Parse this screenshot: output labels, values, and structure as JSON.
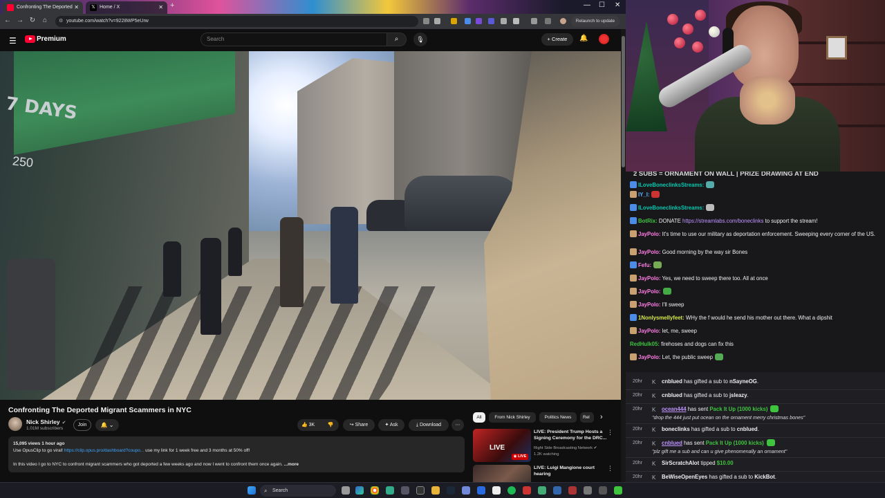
{
  "browser": {
    "tabs": [
      {
        "label": "Confronting The Deported",
        "active": true
      },
      {
        "label": "Home / X",
        "active": false
      }
    ],
    "new_tab": "+",
    "url": "youtube.com/watch?v=9228WP5eUrw",
    "relaunch_label": "Relaunch to update",
    "window_controls": {
      "minimize": "—",
      "maximize": "☐",
      "close": "✕"
    }
  },
  "youtube": {
    "brand": "Premium",
    "search_placeholder": "Search",
    "create_label": "+ Create",
    "video": {
      "overlay_days": "7 DAYS",
      "overlay_num": "250",
      "title": "Confronting The Deported Migrant Scammers in NYC",
      "channel": "Nick Shirley",
      "verified": "✔",
      "subscribers": "1.01M subscribers",
      "join_label": "Join",
      "subscribed_label": "🔔 ⌄",
      "actions": {
        "likes": "👍 3K",
        "dislike": "👎",
        "share": "↪ Share",
        "ask": "✦ Ask",
        "download": "⤓ Download",
        "more": "⋯"
      },
      "description": {
        "stats": "15,095 views  1 hour ago",
        "line1_pre": "Use OpusClip to go viral! ",
        "line1_link": "https://clip.opus.pro/dashboard?coupo...",
        "line1_post": " use my link for 1 week free and 3 months at 50% off!",
        "line2": "In this video I go to NYC to confront migrant scammers who got deported a few weeks ago and now I went to confront them once again. ",
        "more": "...more"
      }
    },
    "chips": [
      "All",
      "From Nick Shirley",
      "Politics News",
      "Rel"
    ],
    "chips_next": "›",
    "recommendations": [
      {
        "title": "LIVE: President Trump Hosts a Signing Ceremony for the DRC...",
        "channel": "Right Side Broadcasting Network ✔",
        "meta": "1.2K watching",
        "badge": "LIVE",
        "thumb_live": "LIVE"
      },
      {
        "title": "LIVE: Luigi Mangione court hearing",
        "channel": "",
        "meta": ""
      }
    ]
  },
  "stream": {
    "banner": "2 SUBS = ORNAMENT ON WALL | PRIZE DRAWING AT END",
    "messages": [
      {
        "user": "ILoveBoneclinksStreams:",
        "color": "#00c8af",
        "text": ""
      },
      {
        "user": "IY_I:",
        "color": "#5fb0ff",
        "text": ""
      },
      {
        "user": "ILoveBoneclinksStreams:",
        "color": "#00c8af",
        "text": ""
      },
      {
        "user": "BotRix:",
        "color": "#3ec43e",
        "text": " DONATE ",
        "link": "https://streamlabs.com/boneclinks",
        "after": " to support the stream!"
      },
      {
        "user": "JayPolo:",
        "color": "#ff7ee4",
        "text": " It's time to use our military as deportation enforcement. Sweeping every corner of the US."
      },
      {
        "user": "JayPolo:",
        "color": "#ff7ee4",
        "text": " Good morning by the way sir Bones"
      },
      {
        "user": "Fefu:",
        "color": "#ff7ee4",
        "text": ""
      },
      {
        "user": "JayPolo:",
        "color": "#ff7ee4",
        "text": " Yes, we need to sweep there too. All at once"
      },
      {
        "user": "JayPolo:",
        "color": "#ff7ee4",
        "text": ""
      },
      {
        "user": "JayPolo:",
        "color": "#ff7ee4",
        "text": " I'll sweep"
      },
      {
        "user": "1Nonlysmellyfeet:",
        "color": "#d6e94a",
        "text": " WHy the f would he send his mother out there. What a dipshit"
      },
      {
        "user": "JayPolo:",
        "color": "#ff7ee4",
        "text": " let, me, sweep"
      },
      {
        "user": "RedHulk05:",
        "color": "#3ec43e",
        "text": " firehoses and dogs can fix this"
      },
      {
        "user": "JayPolo:",
        "color": "#ff7ee4",
        "text": " Let, the public sweep"
      }
    ],
    "events": [
      {
        "time": "20hr",
        "icon": "K",
        "parts": [
          {
            "u": "cnblued"
          },
          {
            "t": " has gifted a sub to "
          },
          {
            "u": "nSayneOG"
          },
          {
            "t": "."
          }
        ]
      },
      {
        "time": "20hr",
        "icon": "K",
        "parts": [
          {
            "u": "cnblued"
          },
          {
            "t": " has gifted a sub to "
          },
          {
            "u": "jsleazy"
          },
          {
            "t": "."
          }
        ]
      },
      {
        "time": "20hr",
        "icon": "K",
        "parts": [
          {
            "uu": "ocean444"
          },
          {
            "t": " has sent "
          },
          {
            "g": "Pack It Up (1000 kicks)"
          }
        ],
        "sub": "\"drop the 444 just put ocean on the ornament merry christmas bones\""
      },
      {
        "time": "20hr",
        "icon": "K",
        "parts": [
          {
            "u": "boneclinks"
          },
          {
            "t": " has gifted a sub to "
          },
          {
            "u": "cnblued"
          },
          {
            "t": "."
          }
        ]
      },
      {
        "time": "20hr",
        "icon": "K",
        "parts": [
          {
            "uu": "cnblued"
          },
          {
            "t": " has sent "
          },
          {
            "g": "Pack It Up (1000 kicks)"
          }
        ],
        "sub": "\"plz gift me a sub and can u give phenomenally an ornament\""
      },
      {
        "time": "20hr",
        "icon": "K",
        "parts": [
          {
            "u": "SirScratchAlot"
          },
          {
            "t": " tipped "
          },
          {
            "g": "$10.00"
          }
        ]
      },
      {
        "time": "20hr",
        "icon": "K",
        "parts": [
          {
            "u": "BeWiseOpenEyes"
          },
          {
            "t": " has gifted a sub to "
          },
          {
            "u": "KickBot"
          },
          {
            "t": "."
          }
        ]
      }
    ]
  },
  "taskbar": {
    "search_placeholder": "Search"
  },
  "colors": {
    "yt_red": "#ff0033",
    "kick_green": "#3ec43e",
    "chat_bg": "#18181b",
    "yt_bg": "#0f0f0f"
  }
}
